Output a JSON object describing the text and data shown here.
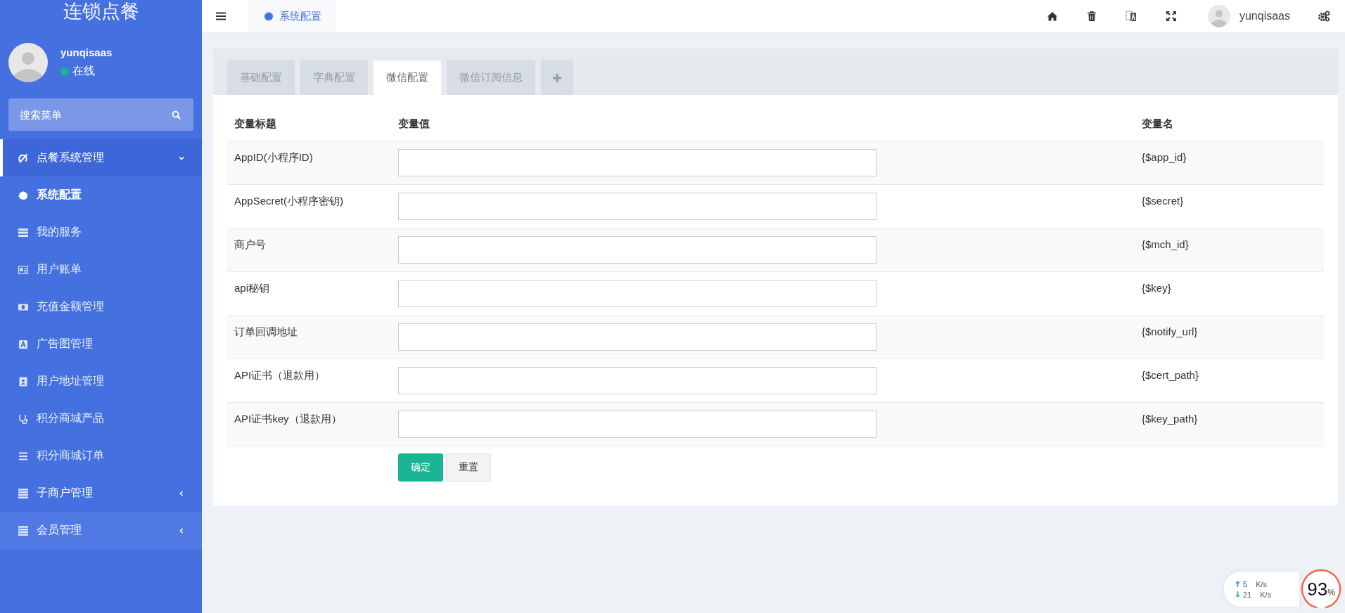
{
  "sidebar": {
    "logo": "连锁点餐",
    "user": {
      "name": "yunqisaas",
      "status": "在线",
      "online": true
    },
    "search": {
      "placeholder": "搜索菜单"
    },
    "menu": [
      {
        "label": "点餐系统管理",
        "expanded": true,
        "hovered": false,
        "children": [
          {
            "label": "系统配置",
            "selected": true
          },
          {
            "label": "我的服务",
            "selected": false
          },
          {
            "label": "用户账单",
            "selected": false
          },
          {
            "label": "充值金额管理",
            "selected": false
          },
          {
            "label": "广告图管理",
            "selected": false
          },
          {
            "label": "用户地址管理",
            "selected": false
          },
          {
            "label": "积分商城产品",
            "selected": false
          },
          {
            "label": "积分商城订单",
            "selected": false
          }
        ]
      },
      {
        "label": "子商户管理",
        "expanded": false,
        "hovered": false
      },
      {
        "label": "会员管理",
        "expanded": false,
        "hovered": true
      }
    ]
  },
  "topbar": {
    "page_tabs": [
      {
        "label": "系统配置",
        "selected": true
      }
    ],
    "user": "yunqisaas"
  },
  "config_tabs": [
    {
      "label": "基础配置",
      "selected": false
    },
    {
      "label": "字典配置",
      "selected": false
    },
    {
      "label": "微信配置",
      "selected": true
    },
    {
      "label": "微信订阅信息",
      "selected": false
    }
  ],
  "table": {
    "columns": [
      "变量标题",
      "变量值",
      "变量名"
    ],
    "rows": [
      {
        "title": "AppID(小程序ID)",
        "variable": "{$app_id}"
      },
      {
        "title": "AppSecret(小程序密钥)",
        "variable": "{$secret}"
      },
      {
        "title": "商户号",
        "variable": "{$mch_id}"
      },
      {
        "title": "api秘钥",
        "variable": "{$key}"
      },
      {
        "title": "订单回调地址",
        "variable": "{$notify_url}"
      },
      {
        "title": "API证书（退款用）",
        "variable": "{$cert_path}"
      },
      {
        "title": "API证书key（退款用）",
        "variable": "{$key_path}"
      }
    ]
  },
  "buttons": [
    {
      "label": "确定",
      "kind": "primary"
    },
    {
      "label": "重置",
      "kind": "default"
    }
  ],
  "net_widget": {
    "upload": "5",
    "upload_unit": "K/s",
    "download": "21",
    "download_unit": "K/s",
    "percent": "93",
    "percent_sign": "%",
    "level": 0.93
  }
}
